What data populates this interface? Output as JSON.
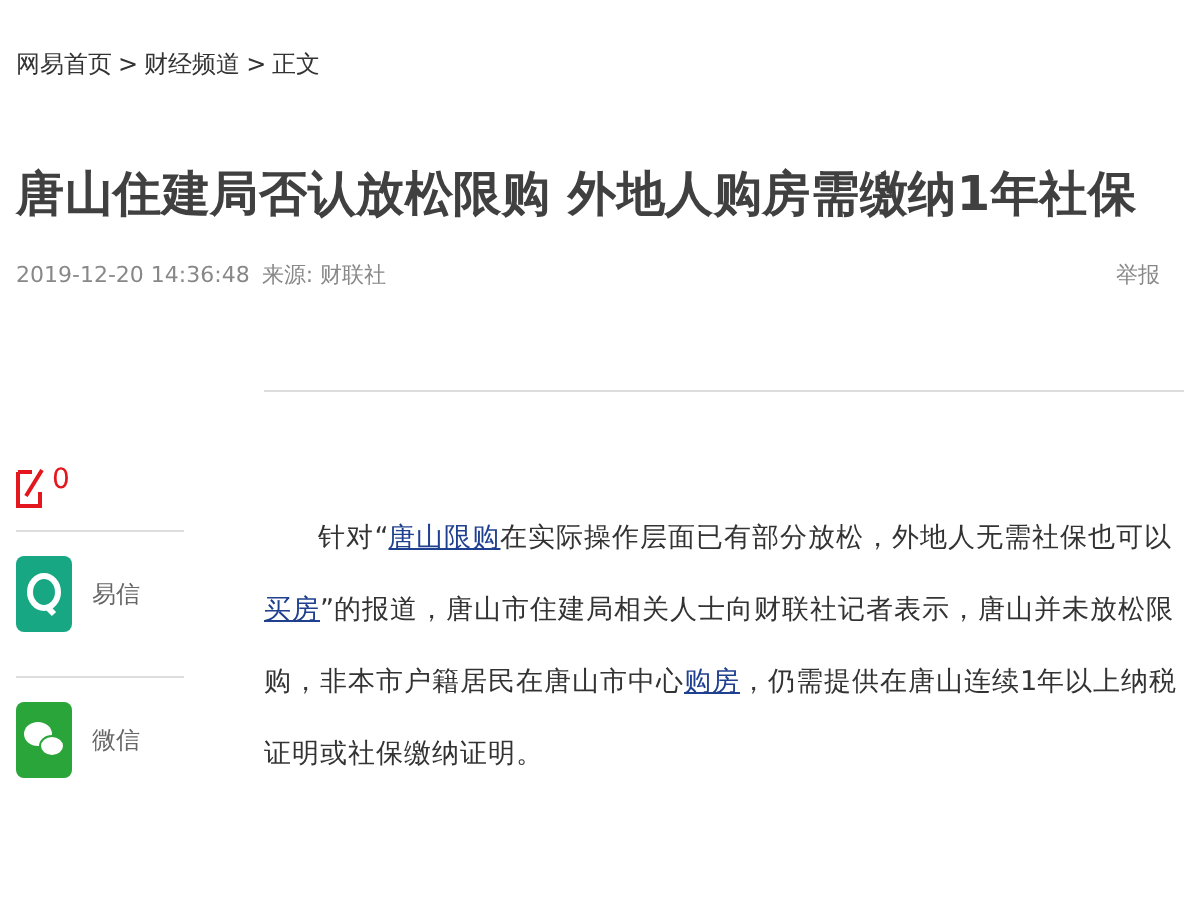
{
  "breadcrumb": [
    {
      "label": "网易首页"
    },
    {
      "label": "财经频道"
    },
    {
      "label": "正文"
    }
  ],
  "separator": ">",
  "title": "唐山住建局否认放松限购 外地人购房需缴纳1年社保",
  "meta": {
    "time": "2019-12-20 14:36:48",
    "source": "来源: 财联社",
    "report": "举报"
  },
  "sidebar": {
    "comment_count": "0",
    "share": [
      {
        "kind": "yixin",
        "label": "易信"
      },
      {
        "kind": "wechat",
        "label": "微信"
      }
    ]
  },
  "paragraph": [
    {
      "kind": "text",
      "text": "针对“"
    },
    {
      "kind": "link",
      "text": "唐山限购"
    },
    {
      "kind": "text",
      "text": "在实际操作层面已有部分放松，外地人无需社保也可以"
    },
    {
      "kind": "link",
      "text": "买房"
    },
    {
      "kind": "text",
      "text": "”的报道，唐山市住建局相关人士向财联社记者表示，唐山并未放松限购，非本市户籍居民在唐山市中心"
    },
    {
      "kind": "link",
      "text": "购房"
    },
    {
      "kind": "text",
      "text": "，仍需提供在唐山连续1年以上纳税证明或社保缴纳证明。"
    }
  ]
}
